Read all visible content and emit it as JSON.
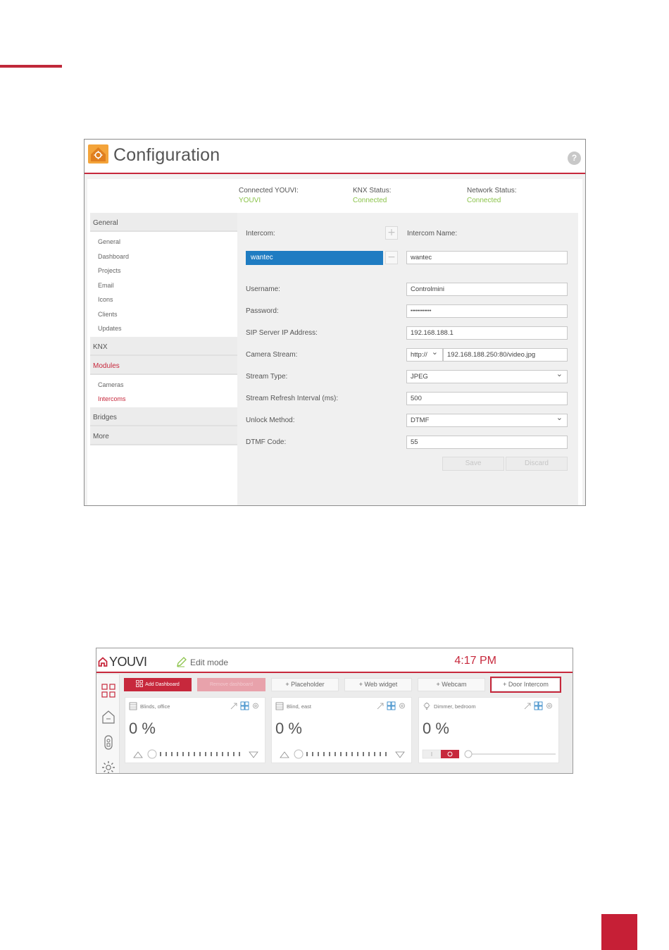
{
  "config": {
    "title": "Configuration",
    "help": "?",
    "status": [
      {
        "label": "Connected YOUVI:",
        "value": "YOUVI"
      },
      {
        "label": "KNX Status:",
        "value": "Connected"
      },
      {
        "label": "Network Status:",
        "value": "Connected"
      }
    ],
    "sidebar": {
      "general": "General",
      "general_items": [
        "General",
        "Dashboard",
        "Projects",
        "Email",
        "Icons",
        "Clients",
        "Updates"
      ],
      "knx": "KNX",
      "modules": "Modules",
      "modules_items": [
        "Cameras",
        "Intercoms"
      ],
      "bridges": "Bridges",
      "more": "More"
    },
    "form": {
      "intercom_label": "Intercom:",
      "intercom_name_label": "Intercom Name:",
      "selected_intercom": "wantec",
      "intercom_name": "wantec",
      "username_label": "Username:",
      "username": "Controlmini",
      "password_label": "Password:",
      "password": "••••••••••••",
      "sip_label": "SIP Server IP Address:",
      "sip": "192.168.188.1",
      "camera_label": "Camera Stream:",
      "camera_protocol": "http://",
      "camera_url": "192.168.188.250:80/video.jpg",
      "stream_type_label": "Stream Type:",
      "stream_type": "JPEG",
      "refresh_label": "Stream Refresh Interval (ms):",
      "refresh": "500",
      "unlock_label": "Unlock Method:",
      "unlock": "DTMF",
      "dtmf_label": "DTMF Code:",
      "dtmf": "55",
      "save": "Save",
      "discard": "Discard"
    }
  },
  "dashboard": {
    "logo": "YOUVI",
    "edit_mode": "Edit mode",
    "time": "4:17 PM",
    "toolbar": {
      "add_dashboard": "Add Dashboard",
      "remove_dashboard": "Remove dashboard",
      "placeholder": "Placeholder",
      "web_widget": "Web widget",
      "webcam": "Webcam",
      "door_intercom": "Door Intercom"
    },
    "cards": [
      {
        "title": "Blinds, office",
        "value": "0 %",
        "icon": "blinds-icon"
      },
      {
        "title": "Blind, east",
        "value": "0 %",
        "icon": "blinds-icon"
      },
      {
        "title": "Dimmer, bedroom",
        "value": "0 %",
        "icon": "bulb-icon"
      }
    ],
    "colors": {
      "accent": "#c7283c",
      "selection": "#1f7cc2",
      "connected": "#8bc34a"
    }
  }
}
